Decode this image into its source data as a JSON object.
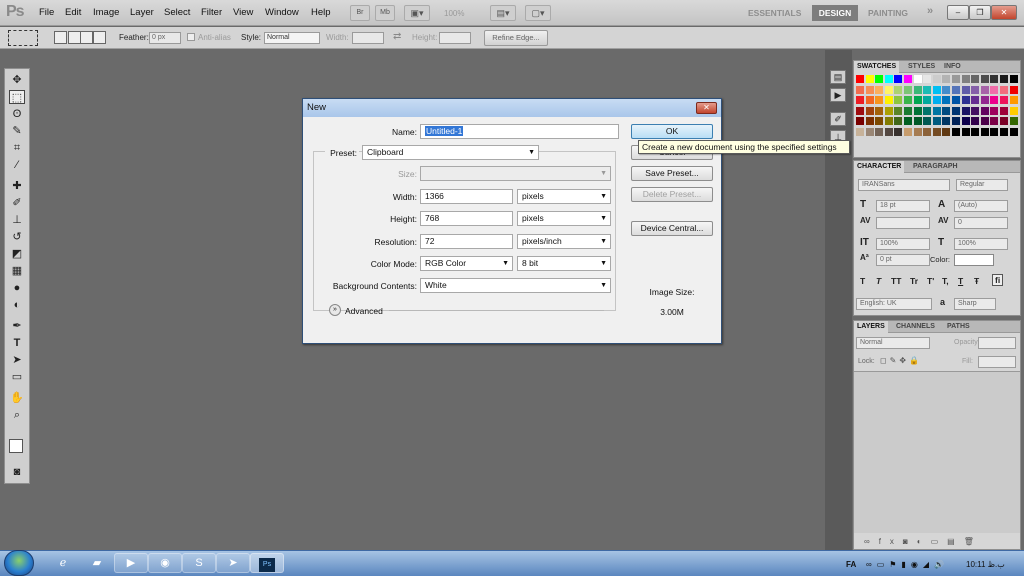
{
  "app": {
    "logo": "Ps"
  },
  "menu": [
    "File",
    "Edit",
    "Image",
    "Layer",
    "Select",
    "Filter",
    "View",
    "Window",
    "Help"
  ],
  "menubar": {
    "br": "Br",
    "mb": "Mb",
    "zoom": "100%",
    "workspaces": [
      "ESSENTIALS",
      "DESIGN",
      "PAINTING"
    ],
    "more": "»",
    "win_min": "–",
    "win_max": "❐",
    "win_close": "✕"
  },
  "options": {
    "feather_label": "Feather:",
    "feather_value": "0 px",
    "antialias": "Anti-alias",
    "style_label": "Style:",
    "style_value": "Normal",
    "width_label": "Width:",
    "height_label": "Height:",
    "refine": "Refine Edge..."
  },
  "dialog": {
    "title": "New",
    "name_label": "Name:",
    "name_value": "Untitled-1",
    "preset_label": "Preset:",
    "preset_value": "Clipboard",
    "size_label": "Size:",
    "width_label": "Width:",
    "width_value": "1366",
    "width_unit": "pixels",
    "height_label": "Height:",
    "height_value": "768",
    "height_unit": "pixels",
    "resolution_label": "Resolution:",
    "resolution_value": "72",
    "resolution_unit": "pixels/inch",
    "colormode_label": "Color Mode:",
    "colormode_value": "RGB Color",
    "colormode_bits": "8 bit",
    "bg_label": "Background Contents:",
    "bg_value": "White",
    "advanced": "Advanced",
    "ok": "OK",
    "cancel": "Cancel",
    "save_preset": "Save Preset...",
    "delete_preset": "Delete Preset...",
    "device_central": "Device Central...",
    "image_size_label": "Image Size:",
    "image_size_value": "3.00M",
    "tooltip": "Create a new document using the specified settings"
  },
  "swatches": {
    "tabs": [
      "SWATCHES",
      "STYLES",
      "INFO"
    ],
    "rows": [
      [
        "#ff0000",
        "#ffff00",
        "#00ff00",
        "#00ffff",
        "#0000ff",
        "#ff00ff",
        "#ffffff",
        "#e6e6e6",
        "#cccccc",
        "#b3b3b3",
        "#999999",
        "#808080",
        "#666666",
        "#4d4d4d",
        "#333333",
        "#1a1a1a",
        "#000000"
      ],
      [
        "#f26c4f",
        "#f68e55",
        "#fbaf5d",
        "#fff467",
        "#acd372",
        "#7cc576",
        "#3bb878",
        "#1abbb4",
        "#00bff3",
        "#438ccb",
        "#5574b9",
        "#605ca8",
        "#855fa8",
        "#a763a8",
        "#f06ea9",
        "#f26d7d",
        "#f00000"
      ],
      [
        "#ed1c24",
        "#f26522",
        "#f7941d",
        "#fff200",
        "#8dc63f",
        "#39b54a",
        "#00a651",
        "#00a99d",
        "#00aeef",
        "#0072bc",
        "#0054a6",
        "#2e3192",
        "#662d91",
        "#92278f",
        "#ec008c",
        "#ed145b",
        "#ff9900"
      ],
      [
        "#9e0b0f",
        "#a0410d",
        "#a36209",
        "#aba000",
        "#598527",
        "#197b30",
        "#007236",
        "#00746b",
        "#0076a3",
        "#004b80",
        "#003471",
        "#1b1464",
        "#440e62",
        "#630460",
        "#9e005d",
        "#9e0039",
        "#ffcc00"
      ],
      [
        "#790000",
        "#7b2e00",
        "#7d4900",
        "#827b00",
        "#406618",
        "#005e20",
        "#005826",
        "#005952",
        "#005b7f",
        "#003663",
        "#002157",
        "#0d004c",
        "#32004b",
        "#4b0049",
        "#7b0046",
        "#7a0026",
        "#336600"
      ],
      [
        "#c7b299",
        "#998675",
        "#736357",
        "#534741",
        "#37302d",
        "#c69c6d",
        "#a67c52",
        "#8c6239",
        "#754c24",
        "#603913",
        "#000000",
        "#000000",
        "#000000",
        "#000000",
        "#000000",
        "#000000",
        "#000000"
      ]
    ]
  },
  "character": {
    "tabs": [
      "CHARACTER",
      "PARAGRAPH"
    ],
    "font": "IRANSans",
    "style": "Regular",
    "size": "18 pt",
    "leading": "(Auto)",
    "tracking": "0",
    "vscale": "100%",
    "hscale": "100%",
    "baseline": "0 pt",
    "color_label": "Color:",
    "language": "English: UK",
    "aa_label": "a",
    "aa_value": "Sharp",
    "glyphs": [
      "T",
      "T",
      "TT",
      "Tr",
      "T'",
      "T,",
      "T",
      "Ŧ",
      "fi"
    ]
  },
  "layers": {
    "tabs": [
      "LAYERS",
      "CHANNELS",
      "PATHS"
    ],
    "blend": "Normal",
    "opacity_label": "Opacity:",
    "lock_label": "Lock:",
    "fill_label": "Fill:"
  },
  "taskbar": {
    "lang": "FA",
    "time": "10:11 ب.ظ"
  },
  "colors": {
    "accent": "#2f6fb6",
    "dialog_title": "#b5cfee",
    "panel": "#d6d6d6"
  }
}
